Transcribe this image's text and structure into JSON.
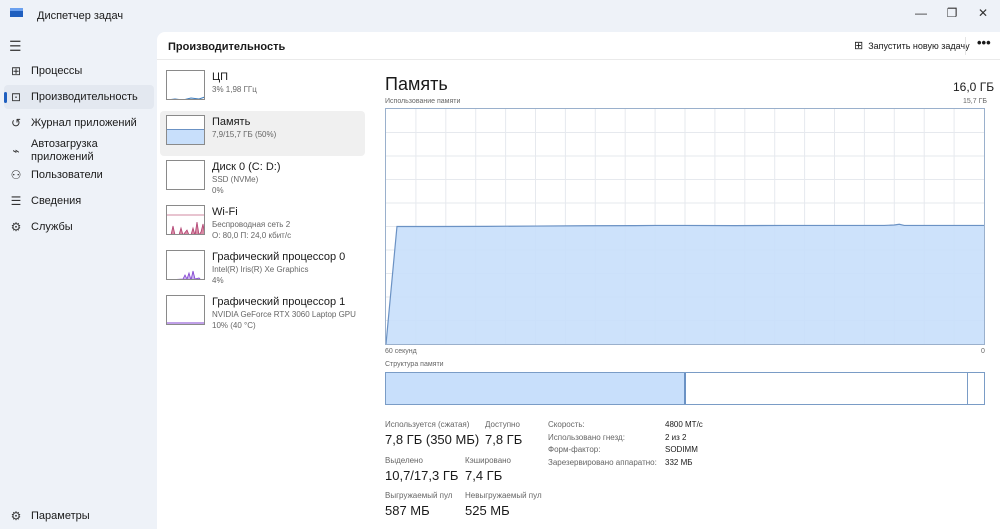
{
  "window": {
    "title": "Диспетчер задач",
    "minimize": "—",
    "restore": "❐",
    "close": "✕"
  },
  "sidebar": {
    "items": [
      {
        "label": "Процессы",
        "icon": "processes-icon",
        "glyph": "⊞"
      },
      {
        "label": "Производительность",
        "icon": "performance-icon",
        "glyph": "⊡"
      },
      {
        "label": "Журнал приложений",
        "icon": "history-icon",
        "glyph": "↺"
      },
      {
        "label": "Автозагрузка приложений",
        "icon": "startup-icon",
        "glyph": "⌁"
      },
      {
        "label": "Пользователи",
        "icon": "users-icon",
        "glyph": "⚇"
      },
      {
        "label": "Сведения",
        "icon": "details-icon",
        "glyph": "☰"
      },
      {
        "label": "Службы",
        "icon": "services-icon",
        "glyph": "⚙"
      }
    ],
    "settings": "Параметры"
  },
  "header": {
    "title": "Производительность",
    "new_task": "Запустить новую задачу",
    "more": "•••"
  },
  "devices": [
    {
      "name": "ЦП",
      "sub1": "3% 1,98 ГГц",
      "sub2": ""
    },
    {
      "name": "Память",
      "sub1": "7,9/15,7 ГБ (50%)",
      "sub2": ""
    },
    {
      "name": "Диск 0 (C: D:)",
      "sub1": "SSD (NVMe)",
      "sub2": "0%"
    },
    {
      "name": "Wi-Fi",
      "sub1": "Беспроводная сеть 2",
      "sub2": "О: 80,0 П: 24,0 кбит/с"
    },
    {
      "name": "Графический процессор 0",
      "sub1": "Intel(R) Iris(R) Xe Graphics",
      "sub2": "4%"
    },
    {
      "name": "Графический процессор 1",
      "sub1": "NVIDIA GeForce RTX 3060 Laptop GPU",
      "sub2": "10% (40 °C)"
    }
  ],
  "memory": {
    "title": "Память",
    "total": "16,0 ГБ",
    "usage_label": "Использование памяти",
    "max_label": "15,7 ГБ",
    "x_left": "60 секунд",
    "x_right": "0",
    "structure_label": "Структура памяти",
    "structure": {
      "in_use_pct": 50.2,
      "modified_pct": 47.2,
      "standby_pct": 2.6
    },
    "stats": {
      "in_use_label": "Используется (сжатая)",
      "in_use": "7,8 ГБ (350 МБ)",
      "available_label": "Доступно",
      "available": "7,8 ГБ",
      "committed_label": "Выделено",
      "committed": "10,7/17,3 ГБ",
      "cached_label": "Кэшировано",
      "cached": "7,4 ГБ",
      "paged_label": "Выгружаемый пул",
      "paged": "587 МБ",
      "nonpaged_label": "Невыгружаемый пул",
      "nonpaged": "525 МБ"
    },
    "specs": [
      {
        "k": "Скорость:",
        "v": "4800 МТ/с"
      },
      {
        "k": "Использовано гнезд:",
        "v": "2 из 2"
      },
      {
        "k": "Форм-фактор:",
        "v": "SODIMM"
      },
      {
        "k": "Зарезервировано аппаратно:",
        "v": "332 МБ"
      }
    ]
  },
  "chart_data": {
    "type": "area",
    "title": "Использование памяти",
    "xlabel": "60 секунд",
    "ylim": [
      0,
      15.7
    ],
    "x": [
      60,
      58.9,
      55,
      50,
      45,
      40,
      35,
      33,
      30,
      25,
      20,
      15,
      10,
      9,
      8.5,
      8,
      5,
      0
    ],
    "values": [
      0,
      7.85,
      7.85,
      7.86,
      7.88,
      7.9,
      7.91,
      7.92,
      7.92,
      7.91,
      7.92,
      7.92,
      7.92,
      7.95,
      8.0,
      7.92,
      7.92,
      7.92
    ]
  },
  "colors": {
    "accent": "#1f5fbf",
    "mem_fill": "#c8dffb",
    "mem_line": "#6b92c4"
  }
}
